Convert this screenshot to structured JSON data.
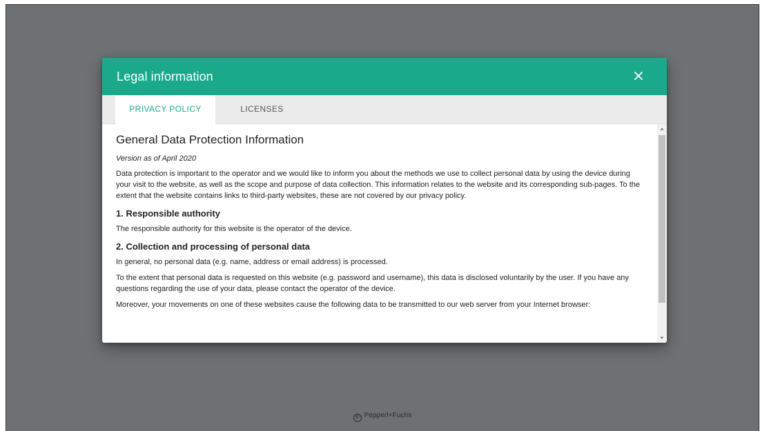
{
  "footer": {
    "copyright_symbol": "©",
    "text": "Pepperl+Fuchs"
  },
  "dialog": {
    "title": "Legal information",
    "close_icon": "close-icon",
    "tabs": [
      {
        "label": "PRIVACY POLICY",
        "active": true
      },
      {
        "label": "LICENSES",
        "active": false
      }
    ],
    "content": {
      "heading": "General Data Protection Information",
      "version": "Version as of April 2020",
      "intro": "Data protection is important to the operator and we would like to inform you about the methods we use to collect personal data by using the device during your visit to the website, as well as the scope and purpose of data collection. This information relates to the website and its corresponding sub-pages. To the extent that the website contains links to third-party websites, these are not covered by our privacy policy.",
      "section1_title": "1. Responsible authority",
      "section1_text": "The responsible authority for this website is the operator of the device.",
      "section2_title": "2. Collection and processing of personal data",
      "section2_p1": "In general, no personal data (e.g. name, address or email address) is processed.",
      "section2_p2": "To the extent that personal data is requested on this website (e.g. password and username), this data is disclosed voluntarily by the user. If you have any questions regarding the use of your data, please contact the operator of the device.",
      "section2_p3": "Moreover, your movements on one of these websites cause the following data to be transmitted to our web server from your Internet browser:"
    }
  },
  "colors": {
    "accent": "#1aa98a",
    "overlay": "#6d7174",
    "tabbar": "#ececec"
  }
}
